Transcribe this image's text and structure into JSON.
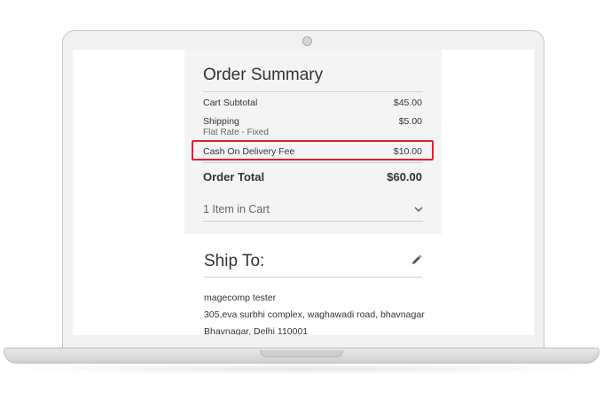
{
  "order_summary": {
    "title": "Order Summary",
    "subtotal": {
      "label": "Cart Subtotal",
      "value": "$45.00"
    },
    "shipping": {
      "label": "Shipping",
      "method": "Flat Rate - Fixed",
      "value": "$5.00"
    },
    "cod_fee": {
      "label": "Cash On Delivery Fee",
      "value": "$10.00"
    },
    "total": {
      "label": "Order Total",
      "value": "$60.00"
    },
    "cart_items": "1 Item in Cart"
  },
  "ship_to": {
    "title": "Ship To:",
    "name": "magecomp tester",
    "address_line": "305,eva surbhi complex, waghawadi road, bhavnagar",
    "city_line": "Bhavnagar, Delhi 110001"
  },
  "colors": {
    "highlight": "#e0202a",
    "summary_bg": "#f4f4f4"
  },
  "icons": {
    "cart_toggle": "chevron-down-icon",
    "edit": "pencil-icon"
  }
}
